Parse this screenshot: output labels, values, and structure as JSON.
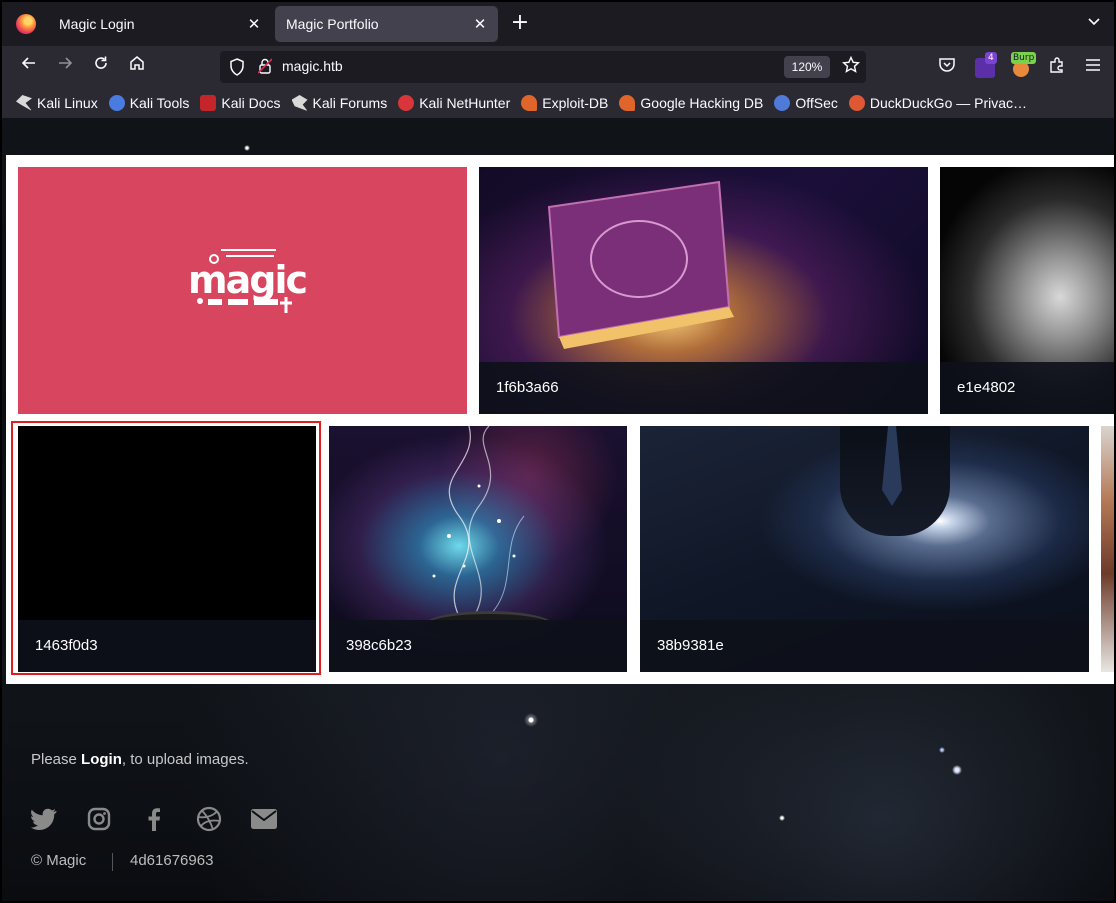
{
  "browser": {
    "tabs": [
      {
        "label": "Magic Login"
      },
      {
        "label": "Magic Portfolio"
      }
    ],
    "url": "magic.htb",
    "zoom": "120%",
    "extension_badge": "4",
    "burp_label": "Burp",
    "bookmarks": [
      {
        "label": "Kali Linux",
        "icon": "kali-dragon-icon",
        "color": "#d9d9d9"
      },
      {
        "label": "Kali Tools",
        "icon": "kali-tools-icon",
        "color": "#4a7be0"
      },
      {
        "label": "Kali Docs",
        "icon": "kali-docs-icon",
        "color": "#c4252b"
      },
      {
        "label": "Kali Forums",
        "icon": "kali-forums-icon",
        "color": "#d9d9d9"
      },
      {
        "label": "Kali NetHunter",
        "icon": "nethunter-icon",
        "color": "#d8363a"
      },
      {
        "label": "Exploit-DB",
        "icon": "exploit-db-icon",
        "color": "#e0652b"
      },
      {
        "label": "Google Hacking DB",
        "icon": "ghdb-icon",
        "color": "#e0652b"
      },
      {
        "label": "OffSec",
        "icon": "offsec-icon",
        "color": "#4f7ad8"
      },
      {
        "label": "DuckDuckGo — Privac…",
        "icon": "duckduckgo-icon",
        "color": "#de5833"
      }
    ]
  },
  "gallery": {
    "cards": [
      {
        "id": "magic-logo",
        "caption": ""
      },
      {
        "id": "book",
        "caption": "1f6b3a66"
      },
      {
        "id": "hand",
        "caption": "e1e4802"
      },
      {
        "id": "black",
        "caption": "1463f0d3"
      },
      {
        "id": "hat",
        "caption": "398c6b23"
      },
      {
        "id": "galaxy",
        "caption": "38b9381e"
      }
    ]
  },
  "footer": {
    "text_before": "Please ",
    "login_link": "Login",
    "text_after": ", to upload images.",
    "socials": [
      "twitter-icon",
      "instagram-icon",
      "facebook-icon",
      "dribbble-icon",
      "email-icon"
    ],
    "copyright": "© Magic",
    "hash": "4d61676963"
  },
  "colors": {
    "highlight": "#e01e1e",
    "magic_card": "#d8455f"
  }
}
